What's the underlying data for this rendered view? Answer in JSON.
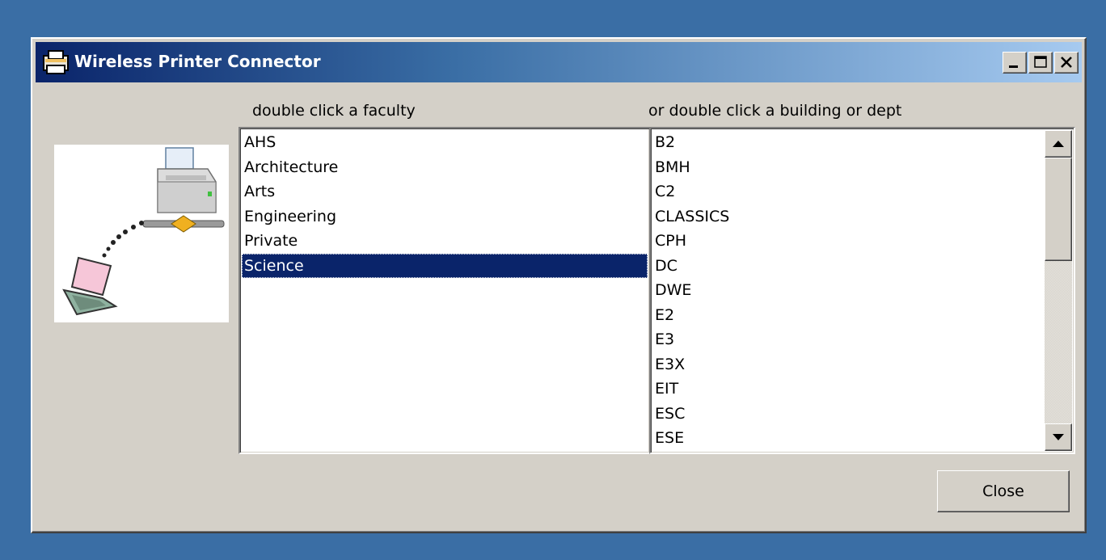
{
  "window": {
    "title": "Wireless Printer Connector",
    "title_icon": "printer-app-icon",
    "controls": {
      "minimize_icon": "minimize-icon",
      "maximize_icon": "maximize-icon",
      "close_icon": "close-icon"
    }
  },
  "labels": {
    "faculty": "double click a faculty",
    "building": "or double click a building or dept"
  },
  "illustration": {
    "icon": "wireless-printer-laptop-illustration"
  },
  "faculty_list": {
    "items": [
      "AHS",
      "Architecture",
      "Arts",
      "Engineering",
      "Private",
      "Science"
    ],
    "selected": "Science"
  },
  "building_list": {
    "items": [
      "B2",
      "BMH",
      "C2",
      "CLASSICS",
      "CPH",
      "DC",
      "DWE",
      "E2",
      "E3",
      "E3X",
      "EIT",
      "ESC",
      "ESE"
    ],
    "scrollbar": {
      "up_icon": "scroll-up-arrow-icon",
      "down_icon": "scroll-down-arrow-icon"
    }
  },
  "buttons": {
    "close_label": "Close"
  },
  "colors": {
    "desktop": "#3a6ea5",
    "window_face": "#d4d0c8",
    "selection": "#0a246a",
    "title_start": "#0a246a",
    "title_end": "#a6caf0"
  }
}
